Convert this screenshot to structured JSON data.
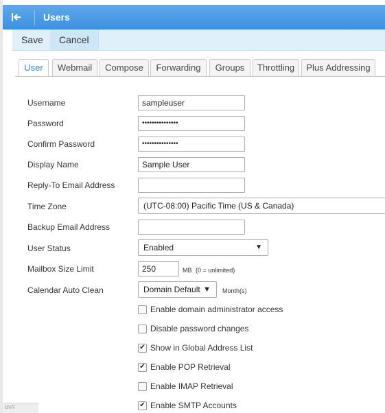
{
  "header": {
    "title": "Users",
    "back_icon": "collapse-left-icon"
  },
  "toolbar": {
    "save_label": "Save",
    "cancel_label": "Cancel"
  },
  "tabs": [
    {
      "label": "User",
      "active": true
    },
    {
      "label": "Webmail"
    },
    {
      "label": "Compose"
    },
    {
      "label": "Forwarding"
    },
    {
      "label": "Groups"
    },
    {
      "label": "Throttling"
    },
    {
      "label": "Plus Addressing"
    }
  ],
  "form": {
    "username": {
      "label": "Username",
      "value": "sampleuser"
    },
    "password": {
      "label": "Password",
      "value": "•••••••••••••••"
    },
    "confirm_password": {
      "label": "Confirm Password",
      "value": "•••••••••••••••"
    },
    "display_name": {
      "label": "Display Name",
      "value": "Sample User"
    },
    "reply_to": {
      "label": "Reply-To Email Address",
      "value": ""
    },
    "time_zone": {
      "label": "Time Zone",
      "value": "(UTC-08:00) Pacific Time (US & Canada)"
    },
    "backup_email": {
      "label": "Backup Email Address",
      "value": ""
    },
    "user_status": {
      "label": "User Status",
      "value": "Enabled"
    },
    "mailbox_size": {
      "label": "Mailbox Size Limit",
      "value": "250",
      "unit": "MB",
      "hint": "(0 = unlimited)"
    },
    "calendar_clean": {
      "label": "Calendar Auto Clean",
      "value": "Domain Default",
      "unit": "Month(s)"
    }
  },
  "checkboxes": [
    {
      "label": "Enable domain administrator access",
      "checked": false
    },
    {
      "label": "Disable password changes",
      "checked": false
    },
    {
      "label": "Show in Global Address List",
      "checked": true
    },
    {
      "label": "Enable POP Retrieval",
      "checked": true
    },
    {
      "label": "Enable IMAP Retrieval",
      "checked": false
    },
    {
      "label": "Enable SMTP Accounts",
      "checked": true
    }
  ],
  "status_bar": {
    "text": "ov#"
  },
  "colors": {
    "header": "#4a9be6",
    "toolbar": "#dff0fb",
    "active_tab_text": "#3a85cf"
  }
}
